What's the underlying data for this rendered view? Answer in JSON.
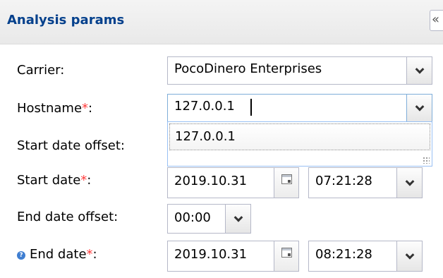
{
  "panel": {
    "title": "Analysis params",
    "collapse_glyph": "«"
  },
  "form": {
    "carrier": {
      "label": "Carrier:",
      "value": "PocoDinero Enterprises"
    },
    "hostname": {
      "label": "Hostname",
      "required_mark": "*",
      "colon": ":",
      "value": "127.0.0.1"
    },
    "start_date_offset": {
      "label": "Start date offset:"
    },
    "start_date": {
      "label": "Start date",
      "required_mark": "*",
      "colon": ":",
      "date": "2019.10.31",
      "time": "07:21:28"
    },
    "end_date_offset": {
      "label": "End date offset:",
      "value": "00:00"
    },
    "end_date": {
      "help_glyph": "?",
      "label": "End date",
      "required_mark": "*",
      "colon": ":",
      "date": "2019.10.31",
      "time": "08:21:28"
    }
  },
  "hostname_dropdown": {
    "options": [
      "127.0.0.1"
    ]
  },
  "colors": {
    "title": "#04408c",
    "required": "#ff3b3b",
    "field_border": "#b5b8c8",
    "focus_border": "#7eadd9",
    "help_icon": "#3f7ed1"
  },
  "icons": {
    "collapse": "double-chevron-left-icon",
    "dropdown": "chevron-down-icon",
    "calendar": "calendar-icon",
    "help": "help-icon"
  }
}
